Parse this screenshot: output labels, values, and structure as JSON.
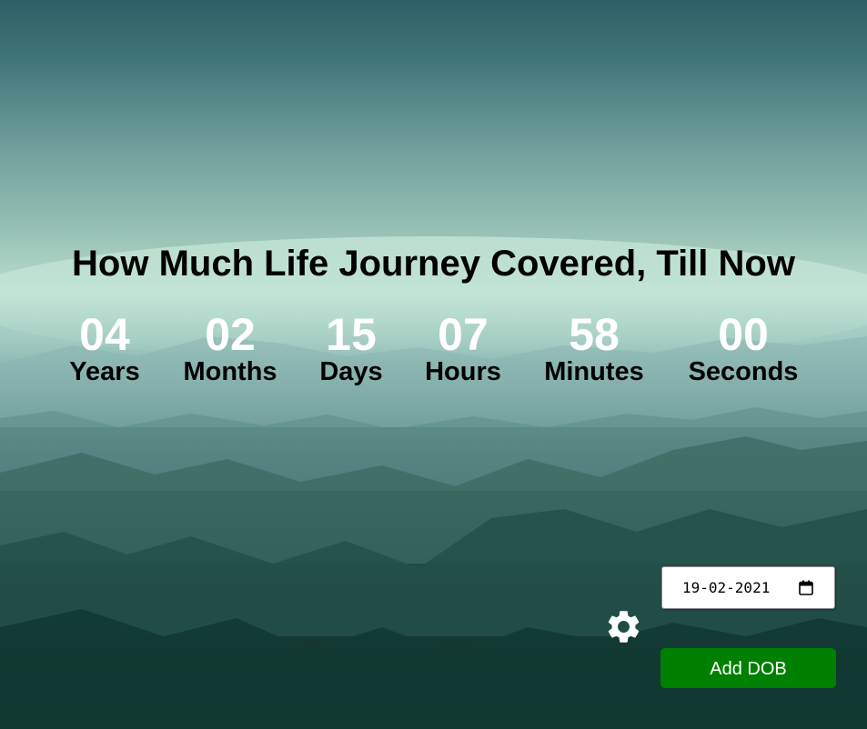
{
  "title": "How Much Life Journey Covered, Till Now",
  "counters": [
    {
      "value": "04",
      "label": "Years"
    },
    {
      "value": "02",
      "label": "Months"
    },
    {
      "value": "15",
      "label": "Days"
    },
    {
      "value": "07",
      "label": "Hours"
    },
    {
      "value": "58",
      "label": "Minutes"
    },
    {
      "value": "00",
      "label": "Seconds"
    }
  ],
  "dob_input": {
    "value": "19-02-2021",
    "icon": "calendar-icon"
  },
  "settings": {
    "icon": "gear-icon"
  },
  "add_button": {
    "label": "Add DOB",
    "color": "#008000"
  }
}
